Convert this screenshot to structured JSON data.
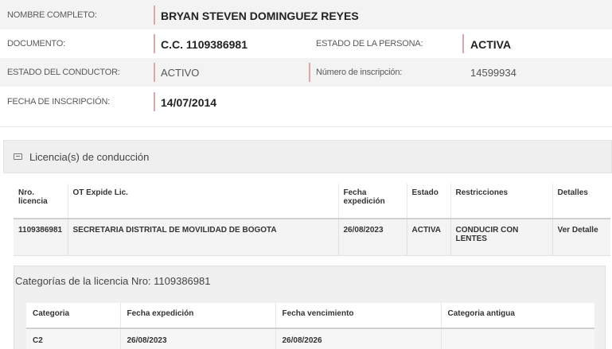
{
  "persona": {
    "nombre_label": "NOMBRE COMPLETO:",
    "nombre_value": "BRYAN STEVEN DOMINGUEZ REYES",
    "documento_label": "DOCUMENTO:",
    "documento_value": "C.C. 1109386981",
    "estado_persona_label": "ESTADO DE LA PERSONA:",
    "estado_persona_value": "ACTIVA",
    "estado_conductor_label": "ESTADO DEL CONDUCTOR:",
    "estado_conductor_value": "ACTIVO",
    "inscripcion_num_label": "Número de inscripción:",
    "inscripcion_num_value": "14599934",
    "fecha_inscripcion_label": "FECHA DE INSCRIPCIÓN:",
    "fecha_inscripcion_value": "14/07/2014"
  },
  "licencias": {
    "section_title": "Licencia(s) de conducción",
    "icon": "id-card-icon",
    "headers": {
      "nro": "Nro. licencia",
      "ot": "OT Expide Lic.",
      "fecha": "Fecha expedición",
      "estado": "Estado",
      "restricciones": "Restricciones",
      "detalles": "Detalles"
    },
    "rows": [
      {
        "nro": "1109386981",
        "ot": "SECRETARIA DISTRITAL DE MOVILIDAD DE BOGOTA",
        "fecha": "26/08/2023",
        "estado": "ACTIVA",
        "restricciones": "CONDUCIR CON LENTES",
        "detalles": "Ver Detalle"
      }
    ]
  },
  "categorias": {
    "title": "Categorías de la licencia Nro: 1109386981",
    "headers": {
      "categoria": "Categoria",
      "expedicion": "Fecha expedición",
      "vencimiento": "Fecha vencimiento",
      "antigua": "Categoria antigua"
    },
    "rows": [
      {
        "categoria": "C2",
        "expedicion": "26/08/2023",
        "vencimiento": "26/08/2026",
        "antigua": ""
      }
    ]
  }
}
